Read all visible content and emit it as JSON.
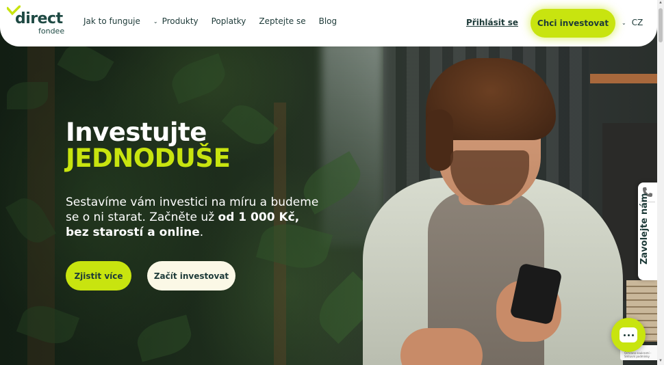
{
  "header": {
    "logo_word": "direct",
    "logo_sub": "fondee",
    "nav": [
      {
        "label": "Jak to funguje",
        "has_dropdown": false
      },
      {
        "label": "Produkty",
        "has_dropdown": true
      },
      {
        "label": "Poplatky",
        "has_dropdown": false
      },
      {
        "label": "Zeptejte se",
        "has_dropdown": false
      },
      {
        "label": "Blog",
        "has_dropdown": false
      }
    ],
    "login_label": "Přihlásit se",
    "cta_label": "Chci investovat",
    "language": "CZ"
  },
  "hero": {
    "title_line1": "Investujte",
    "title_line2": "JEDNODUŠE",
    "lead_part1": "Sestavíme vám investici na míru a budeme se o ni starat. Začněte už ",
    "lead_bold": "od 1 000 Kč, bez starostí a online",
    "lead_part2": ".",
    "btn_more": "Zjistit více",
    "btn_start": "Začít investovat"
  },
  "side_tab": {
    "label": "Zavolejte nám",
    "icon": "phone-icon"
  },
  "chat": {
    "icon": "chat-icon"
  },
  "recaptcha": {
    "text": "Ochrana soukromí - Smluvní podmínky"
  },
  "colors": {
    "accent": "#c8e40f",
    "dark": "#1d3a38",
    "cream": "#fbf8e6"
  }
}
